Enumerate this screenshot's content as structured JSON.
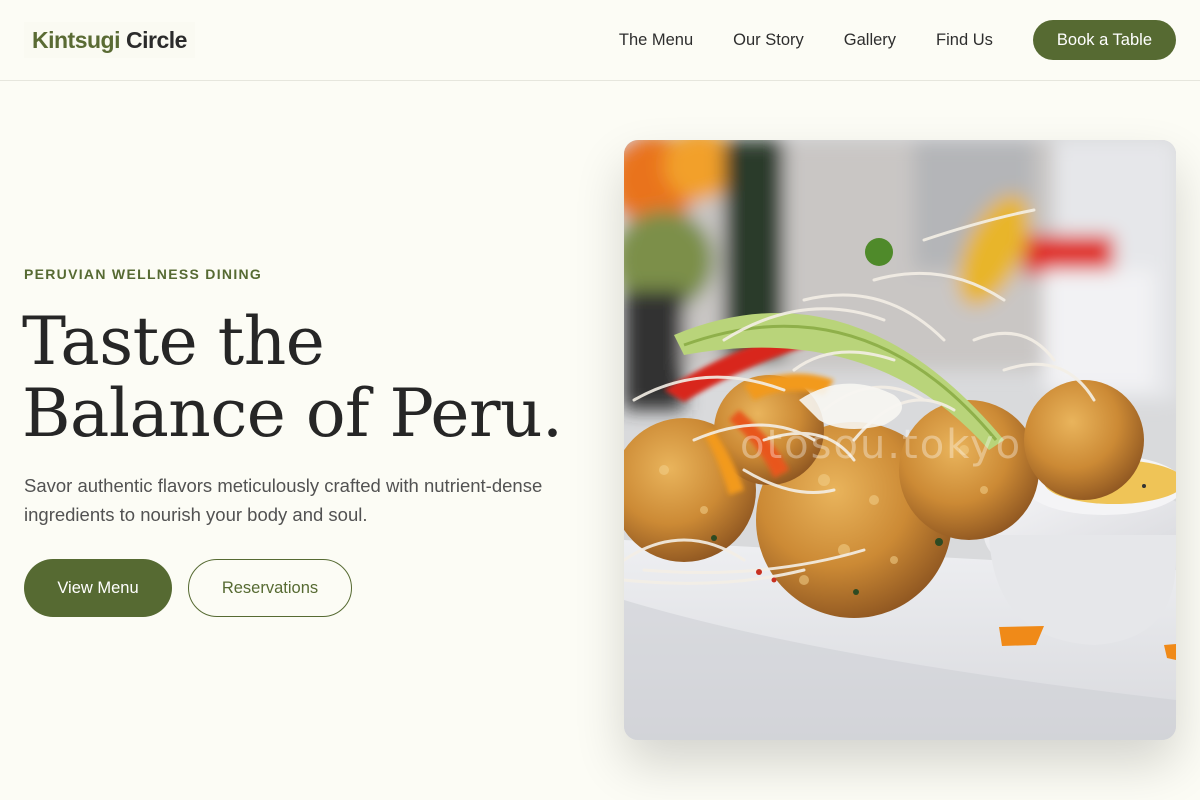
{
  "header": {
    "logo_part1": "Kintsugi",
    "logo_part2": "Circle",
    "nav": [
      {
        "label": "The Menu"
      },
      {
        "label": "Our Story"
      },
      {
        "label": "Gallery"
      },
      {
        "label": "Find Us"
      }
    ],
    "cta_label": "Book a Table"
  },
  "hero": {
    "eyebrow": "PERUVIAN WELLNESS DINING",
    "headline_line1": "Taste the",
    "headline_line2": "Balance of Peru.",
    "lede": "Savor authentic flavors meticulously crafted with nutrient-dense ingredients to nourish your body and soul.",
    "primary_button": "View Menu",
    "secondary_button": "Reservations",
    "image_watermark": "otosou.tokyo"
  },
  "colors": {
    "accent": "#566a32",
    "background": "#fcfcf5",
    "text": "#262626"
  }
}
